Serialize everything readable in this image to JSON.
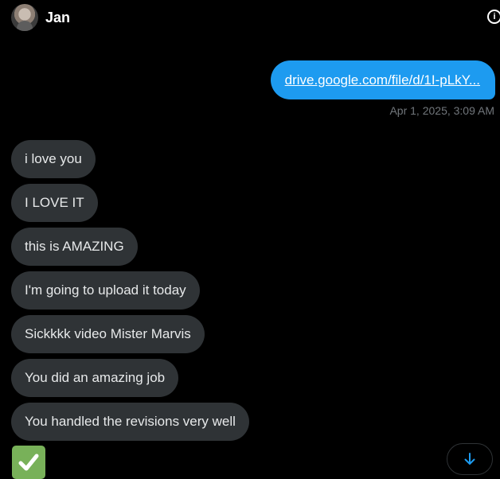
{
  "header": {
    "contact_name": "Jan",
    "info_icon": "info-icon",
    "info_glyph": "i"
  },
  "messages": {
    "sent": [
      {
        "link_text": "drive.google.com/file/d/1I-pLkY...",
        "timestamp": "Apr 1, 2025, 3:09 AM"
      }
    ],
    "received": [
      "i love you",
      "I LOVE IT",
      "this is AMAZING",
      "I'm going to upload it today",
      "Sickkkk video Mister Marvis",
      "You did an amazing job",
      "You handled the revisions very well"
    ],
    "emoji": "check-mark-button-emoji"
  },
  "controls": {
    "scroll_down_icon": "arrow-down-icon"
  },
  "colors": {
    "background": "#000000",
    "sent_bubble": "#1d9bf0",
    "received_bubble": "#2f3336",
    "timestamp": "#71767b",
    "accent": "#1d9bf0",
    "emoji_green": "#78b159"
  }
}
